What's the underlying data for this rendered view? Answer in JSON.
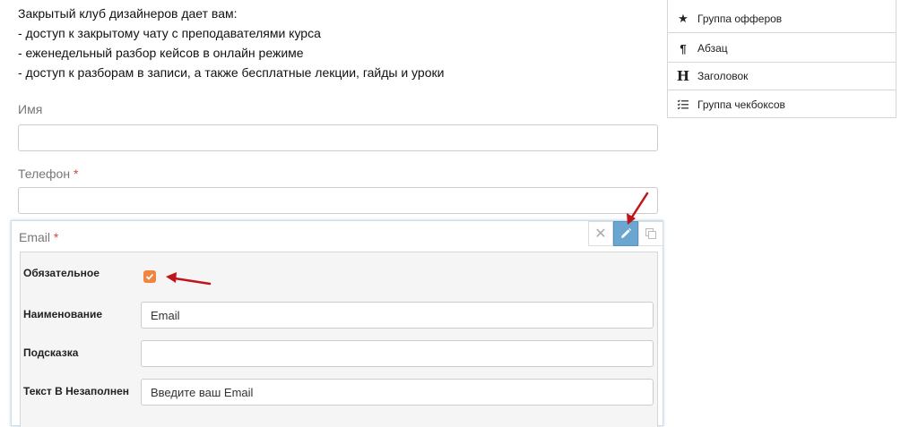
{
  "intro": {
    "lines": [
      "Закрытый клуб дизайнеров дает вам:",
      "- доступ к закрытому чату с преподавателями курса",
      "- еженедельный разбор кейсов в онлайн режиме",
      "- доступ к разборам в записи, а также бесплатные лекции, гайды и уроки"
    ]
  },
  "fields": {
    "name": {
      "label": "Имя",
      "value": ""
    },
    "phone": {
      "label": "Телефон",
      "required_mark": "*",
      "value": ""
    }
  },
  "editor": {
    "title": "Email",
    "required_mark": "*",
    "controls": {
      "remove": "✕"
    },
    "props": {
      "required_label": "Обязательное",
      "required_checked": true,
      "name_label": "Наименование",
      "name_value": "Email",
      "hint_label": "Подсказка",
      "hint_value": "",
      "placeholder_label": "Текст В Незаполненном Поле",
      "placeholder_value": "Введите ваш Email"
    }
  },
  "panel": {
    "items": [
      {
        "label": "Группа офферов",
        "icon": "star-icon"
      },
      {
        "label": "Абзац",
        "icon": "paragraph-icon"
      },
      {
        "label": "Заголовок",
        "icon": "heading-icon"
      },
      {
        "label": "Группа чекбоксов",
        "icon": "checklist-icon"
      }
    ]
  },
  "colors": {
    "accent_orange": "#f0853f",
    "edit_blue": "#6aa6cf",
    "required_red": "#d9453a",
    "arrow_red": "#c0141b"
  }
}
